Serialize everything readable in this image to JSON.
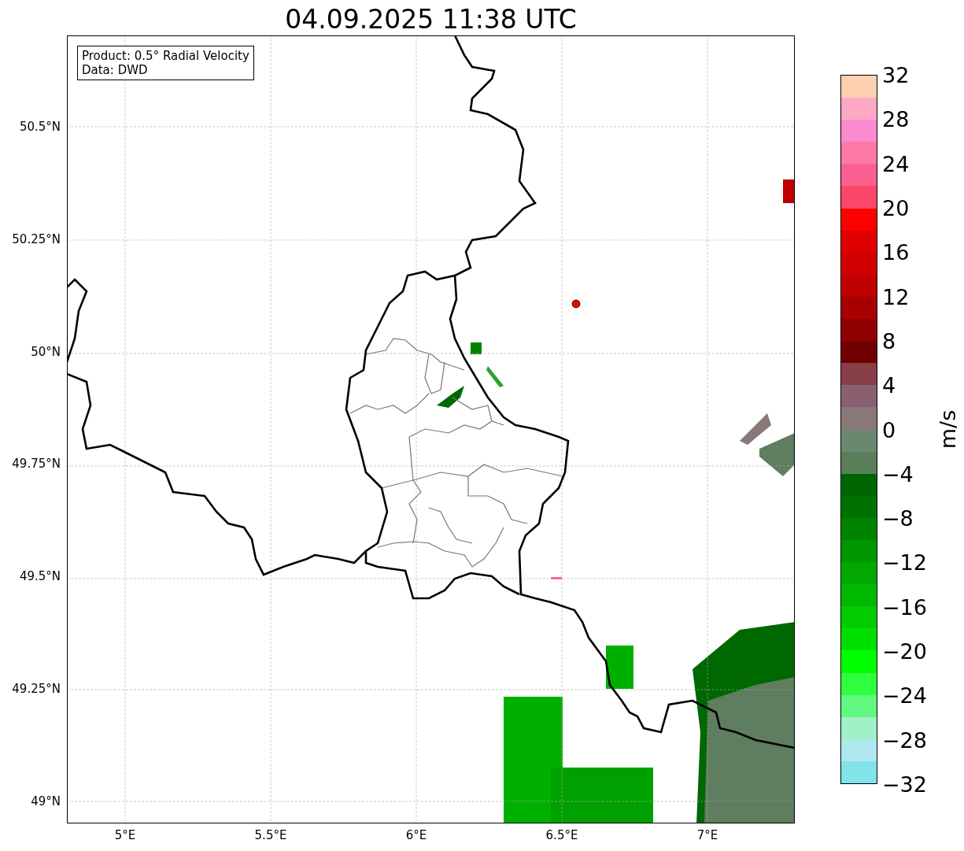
{
  "title": "04.09.2025 11:38 UTC",
  "info_box": {
    "lines": [
      "Product: 0.5° Radial Velocity",
      "Data: DWD"
    ]
  },
  "map": {
    "lat_ticks": [
      "50.5°N",
      "50.25°N",
      "50°N",
      "49.75°N",
      "49.5°N",
      "49.25°N",
      "49°N"
    ],
    "lon_ticks": [
      "5°E",
      "5.5°E",
      "6°E",
      "6.5°E",
      "7°E"
    ]
  },
  "colorbar": {
    "label": "m/s",
    "ticks": [
      "32",
      "28",
      "24",
      "20",
      "16",
      "12",
      "8",
      "4",
      "0",
      "−4",
      "−8",
      "−12",
      "−16",
      "−20",
      "−24",
      "−28",
      "−32"
    ],
    "bins": [
      {
        "color": "#fdd0b0"
      },
      {
        "color": "#fda8c4"
      },
      {
        "color": "#fc8ad0"
      },
      {
        "color": "#fc79a8"
      },
      {
        "color": "#fc6090"
      },
      {
        "color": "#fc4868"
      },
      {
        "color": "#fd0000"
      },
      {
        "color": "#e00000"
      },
      {
        "color": "#d00000"
      },
      {
        "color": "#c00000"
      },
      {
        "color": "#a80000"
      },
      {
        "color": "#900000"
      },
      {
        "color": "#700000"
      },
      {
        "color": "#884048"
      },
      {
        "color": "#886070"
      },
      {
        "color": "#887878"
      },
      {
        "color": "#6a8870"
      },
      {
        "color": "#5a7e5a"
      },
      {
        "color": "#006400"
      },
      {
        "color": "#007200"
      },
      {
        "color": "#008400"
      },
      {
        "color": "#009600"
      },
      {
        "color": "#00a800"
      },
      {
        "color": "#00b800"
      },
      {
        "color": "#00cc00"
      },
      {
        "color": "#00e000"
      },
      {
        "color": "#00ff00"
      },
      {
        "color": "#30ff40"
      },
      {
        "color": "#60f880"
      },
      {
        "color": "#a0f0c8"
      },
      {
        "color": "#b0e8f0"
      },
      {
        "color": "#80e4e8"
      }
    ]
  }
}
